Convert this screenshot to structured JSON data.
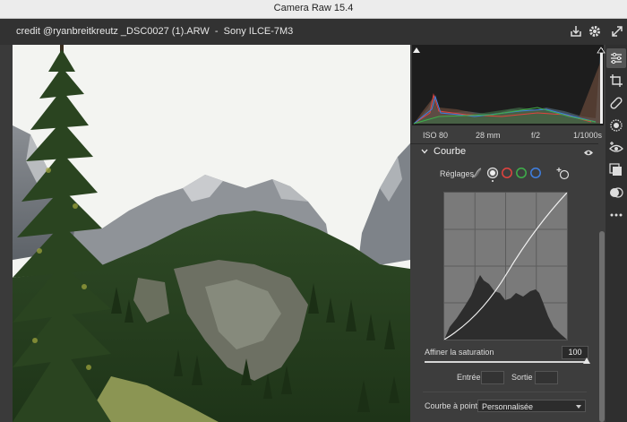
{
  "window": {
    "title": "Camera Raw 15.4"
  },
  "header": {
    "file_info": "credit @ryanbreitkreutz _DSC0027 (1).ARW  -  Sony ILCE-7M3"
  },
  "exif": {
    "iso": "ISO 80",
    "focal": "28 mm",
    "aperture": "f/2",
    "shutter": "1/1000s"
  },
  "curve_panel": {
    "title": "Courbe",
    "settings_label": "Réglages",
    "saturation_label": "Affiner la saturation",
    "saturation_value": "100",
    "saturation_fraction": 1.0,
    "input_label": "Entrée :",
    "output_label": "Sortie :",
    "point_curve_label": "Courbe à points",
    "point_curve_value": "Personnalisée"
  },
  "channel_colors": {
    "red": "#e0433f",
    "green": "#3fae4a",
    "blue": "#3f7fe0"
  },
  "toolbar_icons": [
    "edit-sliders-icon",
    "crop-icon",
    "healing-icon",
    "mask-icon",
    "redeye-icon",
    "presets-icon",
    "snapshots-icon",
    "more-icon"
  ]
}
